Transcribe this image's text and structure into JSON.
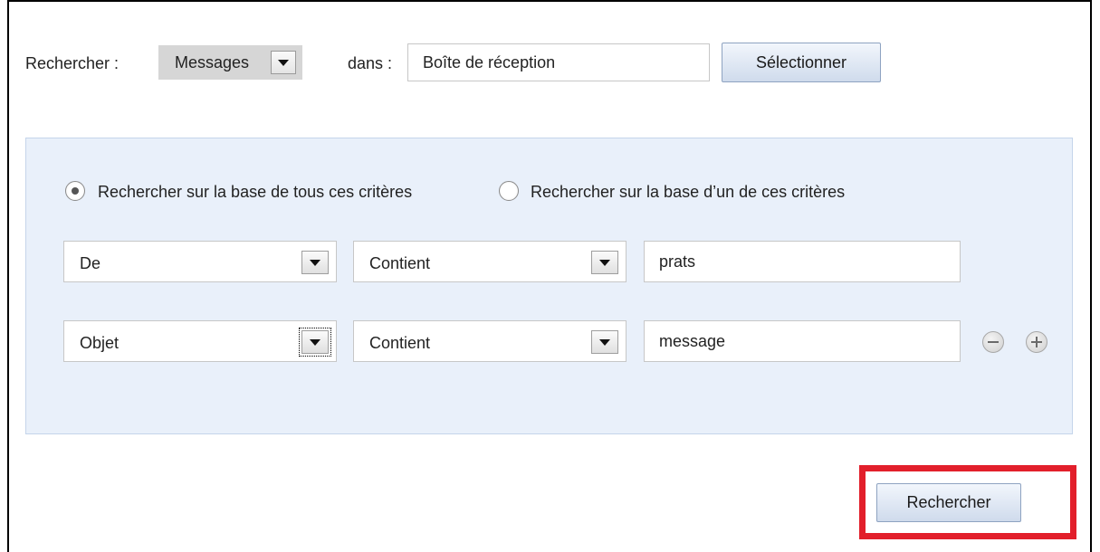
{
  "header": {
    "search_label": "Rechercher :",
    "type_select_value": "Messages",
    "in_label": "dans :",
    "folder_value": "Boîte de réception",
    "select_button": "Sélectionner"
  },
  "criteria": {
    "match_all_label": "Rechercher sur la base de tous ces critères",
    "match_any_label": "Rechercher sur la base d’un de ces critères",
    "rows": [
      {
        "field": "De",
        "operator": "Contient",
        "value": "prats"
      },
      {
        "field": "Objet",
        "operator": "Contient",
        "value": "message"
      }
    ]
  },
  "footer": {
    "search_button": "Rechercher"
  },
  "colors": {
    "panel_bg": "#e9f0fa",
    "highlight": "#e21f2b"
  }
}
